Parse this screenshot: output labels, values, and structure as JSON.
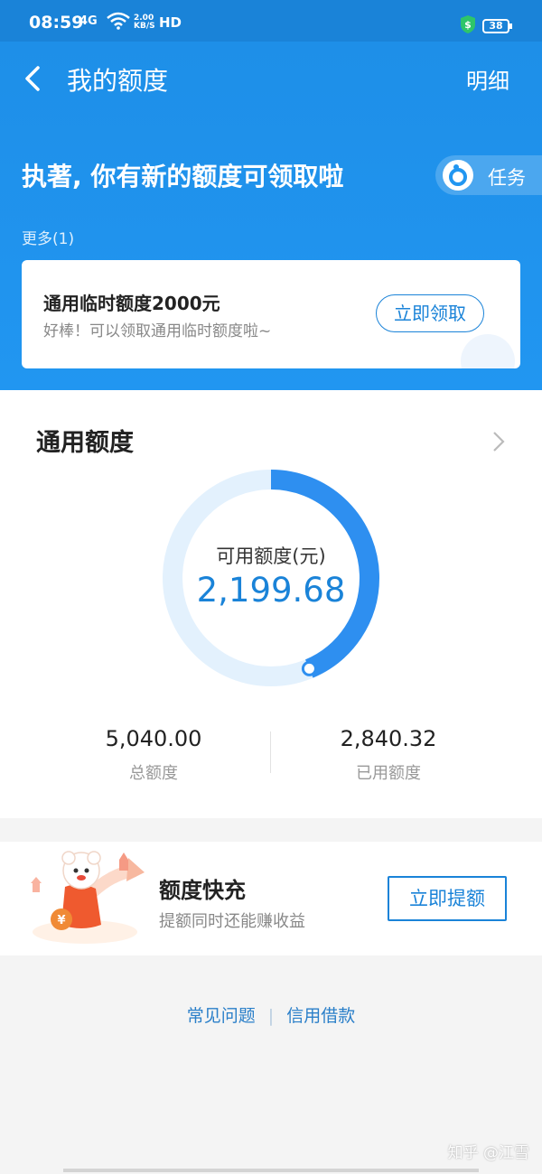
{
  "status_bar": {
    "time": "08:59",
    "signal": "4G",
    "speed_value": "2.00",
    "speed_unit": "KB/S",
    "hd": "HD",
    "battery": "38"
  },
  "header": {
    "title": "我的额度",
    "detail_label": "明细",
    "headline": "执著, 你有新的额度可领取啦",
    "task_label": "任务",
    "more_label": "更多(1)"
  },
  "claim_card": {
    "title": "通用临时额度2000元",
    "subtitle": "好棒！可以领取通用临时额度啦~",
    "button_label": "立即领取"
  },
  "quota": {
    "title": "通用额度",
    "available_label": "可用额度(元)",
    "available_value": "2,199.68",
    "available_ratio": 0.4364,
    "total_value": "5,040.00",
    "total_label": "总额度",
    "used_value": "2,840.32",
    "used_label": "已用额度"
  },
  "boost": {
    "title": "额度快充",
    "subtitle": "提额同时还能赚收益",
    "button_label": "立即提额",
    "coin_symbol": "¥"
  },
  "footer": {
    "link_faq": "常见问题",
    "separator": "|",
    "link_credit": "信用借款",
    "watermark": "知乎 @江雪"
  },
  "colors": {
    "primary": "#1a83d8",
    "header_bg": "#2196f1",
    "ring_track": "#e3f1fd",
    "ring_progress": "#2e8ff0"
  }
}
